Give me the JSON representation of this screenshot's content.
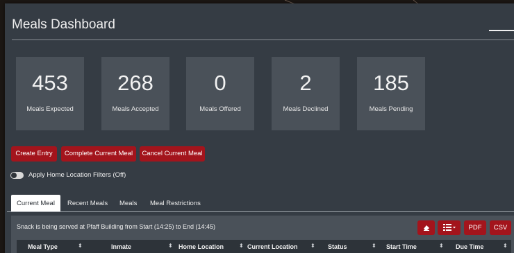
{
  "header": {
    "title": "Meals Dashboard"
  },
  "stats": [
    {
      "value": "453",
      "label": "Meals Expected"
    },
    {
      "value": "268",
      "label": "Meals Accepted"
    },
    {
      "value": "0",
      "label": "Meals Offered"
    },
    {
      "value": "2",
      "label": "Meals Declined"
    },
    {
      "value": "185",
      "label": "Meals Pending"
    }
  ],
  "actions": {
    "create": "Create Entry",
    "complete": "Complete Current Meal",
    "cancel": "Cancel Current Meal"
  },
  "filter_toggle": {
    "label": "Apply Home Location Filters (Off)",
    "on": false
  },
  "tabs": [
    {
      "label": "Current Meal",
      "active": true
    },
    {
      "label": "Recent Meals",
      "active": false
    },
    {
      "label": "Meals",
      "active": false
    },
    {
      "label": "Meal Restrictions",
      "active": false
    }
  ],
  "table": {
    "serving_text": "Snack is being served at Pfaff Building from Start (14:25) to End (14:45)",
    "tools": {
      "eraser_icon": "eraser-icon",
      "columns_icon": "list-columns-icon",
      "pdf": "PDF",
      "csv": "CSV"
    },
    "columns": [
      "Meal Type",
      "Inmate",
      "Home Location",
      "Current Location",
      "Status",
      "Start Time",
      "Due Time"
    ]
  },
  "colors": {
    "accent": "#a3141c",
    "panel": "#353c44",
    "card": "#4a5159",
    "header_row": "#2d3339"
  }
}
